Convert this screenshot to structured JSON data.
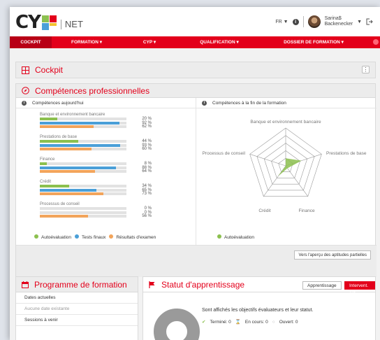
{
  "brand": {
    "logo_letters": "CY",
    "product": "NET",
    "colors": {
      "red": "#e3001b",
      "green": "#8cc04f",
      "blue": "#4a9fd8",
      "orange": "#f2a45b"
    }
  },
  "header": {
    "lang": "FR ▼",
    "help_icon": "info-icon",
    "user_first": "Sarina$",
    "user_last": "Backenecker",
    "menu_caret": "▼",
    "logout_icon": "logout-icon"
  },
  "nav": [
    "COCKPIT",
    "FORMATION ▾",
    "CYP ▾",
    "QUALIFICATION ▾",
    "DOSSIER DE FORMATION ▾"
  ],
  "cockpit": {
    "title": "Cockpit",
    "menu": "⋮"
  },
  "competences": {
    "title": "Compétences professionnelles",
    "today_title": "Compétences aujourd'hui",
    "end_title": "Compétences à la fin de la formation",
    "groups": [
      {
        "label": "Banque et environnement bancaire",
        "values": [
          20,
          92,
          62
        ],
        "texts": [
          "20 %",
          "92 %",
          "62 %"
        ]
      },
      {
        "label": "Prestations de base",
        "values": [
          44,
          93,
          60
        ],
        "texts": [
          "44 %",
          "93 %",
          "60 %"
        ]
      },
      {
        "label": "Finance",
        "values": [
          8,
          88,
          64
        ],
        "texts": [
          "8 %",
          "88 %",
          "64 %"
        ]
      },
      {
        "label": "Crédit",
        "values": [
          34,
          65,
          73
        ],
        "texts": [
          "34 %",
          "65 %",
          "73 %"
        ]
      },
      {
        "label": "Processus de conseil",
        "values": [
          0,
          0,
          56
        ],
        "texts": [
          "0 %",
          "0 %",
          "56 %"
        ]
      }
    ],
    "legend": [
      "Autoévaluation",
      "Tests finaux",
      "Résultats d'examen"
    ],
    "radar_labels": [
      "Banque et environnement bancaire",
      "Prestations de base",
      "Finance",
      "Crédit",
      "Processus de conseil"
    ],
    "radar_legend": "Autoévaluation",
    "link": "Vers l'aperçu des aptitudes partielles"
  },
  "chart_data": {
    "type": "bar",
    "categories": [
      "Banque et environnement bancaire",
      "Prestations de base",
      "Finance",
      "Crédit",
      "Processus de conseil"
    ],
    "series": [
      {
        "name": "Autoévaluation",
        "values": [
          20,
          44,
          8,
          34,
          0
        ]
      },
      {
        "name": "Tests finaux",
        "values": [
          92,
          93,
          88,
          65,
          0
        ]
      },
      {
        "name": "Résultats d'examen",
        "values": [
          62,
          60,
          64,
          73,
          56
        ]
      }
    ],
    "ylim": [
      0,
      100
    ]
  },
  "programme": {
    "title": "Programme de formation",
    "items": [
      "Dates actuelles",
      "Aucune date existante",
      "Sessions à venir"
    ]
  },
  "statut": {
    "title": "Statut d'apprentissage",
    "tabs": [
      "Apprentissage",
      "Intervent. act."
    ],
    "desc": "Sont affichés les objectifs évaluateurs et leur statut.",
    "done": "Terminé: 0",
    "ongoing": "En cours: 0",
    "open": "Ouvert: 0"
  }
}
